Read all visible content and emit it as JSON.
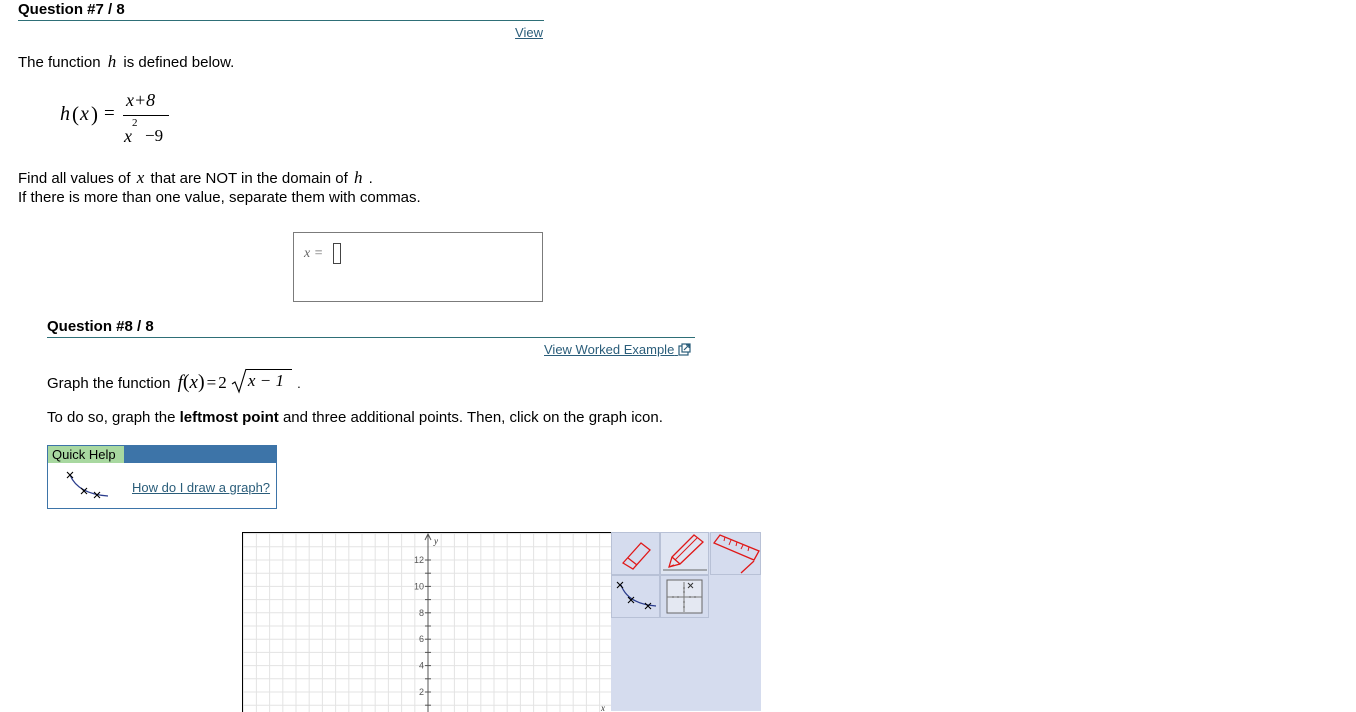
{
  "q7": {
    "title": "Question #7 / 8",
    "view_link": "View",
    "intro_pre": "The function",
    "func_var": "h",
    "intro_post": "is defined below.",
    "formula": {
      "lhs_fn": "h",
      "lhs_arg": "x",
      "numerator": "x+8",
      "denominator_base": "x",
      "denominator_exp": "2",
      "denominator_rest": "−9"
    },
    "prompt1_pre": "Find all values of",
    "prompt1_var": "x",
    "prompt1_mid": "that are NOT in the domain of",
    "prompt1_fn": "h",
    "prompt1_end": ".",
    "prompt2": "If there is more than one value, separate them with commas.",
    "answer_label": "x =",
    "answer_value": ""
  },
  "q8": {
    "title": "Question #8 / 8",
    "worked_example_link": "View Worked Example",
    "graph_pre": "Graph the function",
    "graph_formula": {
      "fn": "f",
      "arg": "x",
      "coef": "2",
      "radicand": "x − 1"
    },
    "graph_end": ".",
    "instr_pre": "To do so, graph the",
    "instr_bold": "leftmost point",
    "instr_post": "and three additional points. Then, click on the graph icon.",
    "quick_help": {
      "label": "Quick Help",
      "link": "How do I draw a graph?"
    },
    "graph": {
      "y_axis_label": "y",
      "x_axis_label": "x",
      "y_ticks": [
        "12",
        "10",
        "8",
        "6",
        "4",
        "2"
      ]
    },
    "tools": [
      "eraser",
      "pencil",
      "ruler",
      "point-plot",
      "grid-toggle"
    ]
  },
  "colors": {
    "rule": "#2e6f77",
    "link": "#2a5d7a",
    "quick_help_header": "#3d74a8",
    "quick_help_label": "#a8d8a0",
    "tool_panel": "#d5dcee",
    "tool_red": "#e01818",
    "plot_blue": "#2a3c8c"
  }
}
